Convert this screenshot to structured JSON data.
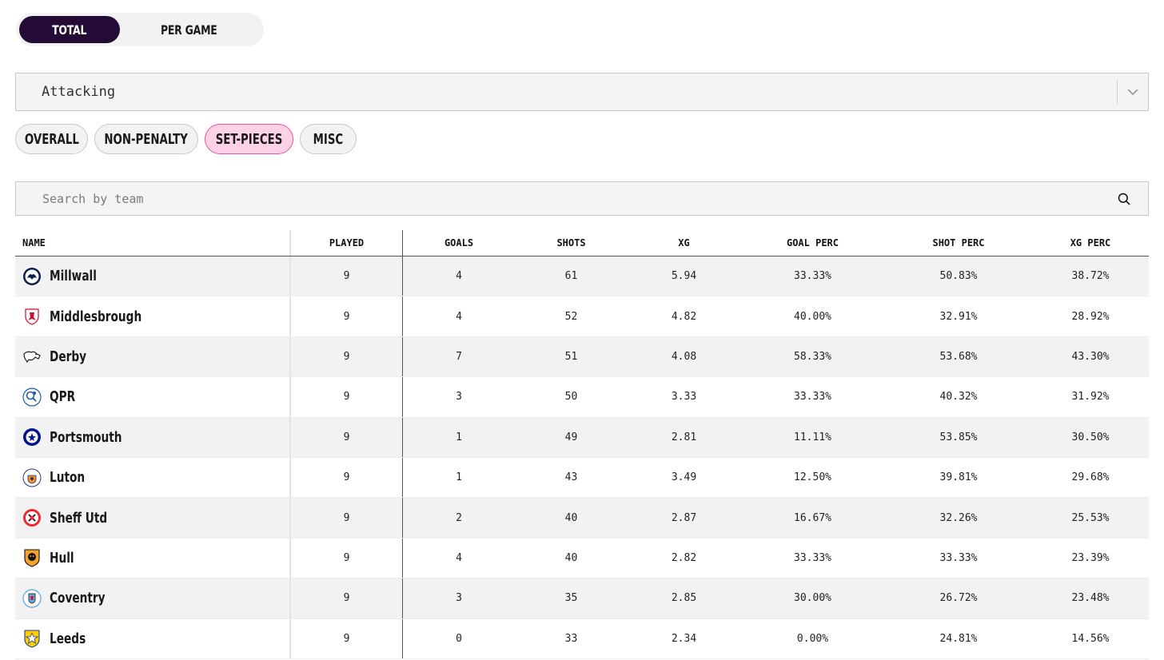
{
  "toggle": {
    "total_label": "TOTAL",
    "per_game_label": "PER GAME"
  },
  "dropdown": {
    "value": "Attacking"
  },
  "filters": [
    {
      "label": "OVERALL",
      "active": false
    },
    {
      "label": "NON-PENALTY",
      "active": false
    },
    {
      "label": "SET-PIECES",
      "active": true
    },
    {
      "label": "MISC",
      "active": false
    }
  ],
  "search": {
    "placeholder": "Search by team"
  },
  "table": {
    "headers": {
      "name": "NAME",
      "played": "PLAYED",
      "goals": "GOALS",
      "shots": "SHOTS",
      "xg": "XG",
      "goal_perc": "GOAL PERC",
      "shot_perc": "SHOT PERC",
      "xg_perc": "XG PERC"
    },
    "rows": [
      {
        "name": "Millwall",
        "played": "9",
        "goals": "4",
        "shots": "61",
        "xg": "5.94",
        "goal_perc": "33.33%",
        "shot_perc": "50.83%",
        "xg_perc": "38.72%",
        "crest": "millwall-crest-icon"
      },
      {
        "name": "Middlesbrough",
        "played": "9",
        "goals": "4",
        "shots": "52",
        "xg": "4.82",
        "goal_perc": "40.00%",
        "shot_perc": "32.91%",
        "xg_perc": "28.92%",
        "crest": "middlesbrough-crest-icon"
      },
      {
        "name": "Derby",
        "played": "9",
        "goals": "7",
        "shots": "51",
        "xg": "4.08",
        "goal_perc": "58.33%",
        "shot_perc": "53.68%",
        "xg_perc": "43.30%",
        "crest": "derby-crest-icon"
      },
      {
        "name": "QPR",
        "played": "9",
        "goals": "3",
        "shots": "50",
        "xg": "3.33",
        "goal_perc": "33.33%",
        "shot_perc": "40.32%",
        "xg_perc": "31.92%",
        "crest": "qpr-crest-icon"
      },
      {
        "name": "Portsmouth",
        "played": "9",
        "goals": "1",
        "shots": "49",
        "xg": "2.81",
        "goal_perc": "11.11%",
        "shot_perc": "53.85%",
        "xg_perc": "30.50%",
        "crest": "portsmouth-crest-icon"
      },
      {
        "name": "Luton",
        "played": "9",
        "goals": "1",
        "shots": "43",
        "xg": "3.49",
        "goal_perc": "12.50%",
        "shot_perc": "39.81%",
        "xg_perc": "29.68%",
        "crest": "luton-crest-icon"
      },
      {
        "name": "Sheff Utd",
        "played": "9",
        "goals": "2",
        "shots": "40",
        "xg": "2.87",
        "goal_perc": "16.67%",
        "shot_perc": "32.26%",
        "xg_perc": "25.53%",
        "crest": "sheff-utd-crest-icon"
      },
      {
        "name": "Hull",
        "played": "9",
        "goals": "4",
        "shots": "40",
        "xg": "2.82",
        "goal_perc": "33.33%",
        "shot_perc": "33.33%",
        "xg_perc": "23.39%",
        "crest": "hull-crest-icon"
      },
      {
        "name": "Coventry",
        "played": "9",
        "goals": "3",
        "shots": "35",
        "xg": "2.85",
        "goal_perc": "30.00%",
        "shot_perc": "26.72%",
        "xg_perc": "23.48%",
        "crest": "coventry-crest-icon"
      },
      {
        "name": "Leeds",
        "played": "9",
        "goals": "0",
        "shots": "33",
        "xg": "2.34",
        "goal_perc": "0.00%",
        "shot_perc": "24.81%",
        "xg_perc": "14.56%",
        "crest": "leeds-crest-icon"
      }
    ]
  },
  "colors": {
    "toggle_active": "#240b36",
    "pill_active_bg": "#fdd1e6",
    "pill_active_border": "#e8559b",
    "row_alt": "#f2f2f2"
  }
}
